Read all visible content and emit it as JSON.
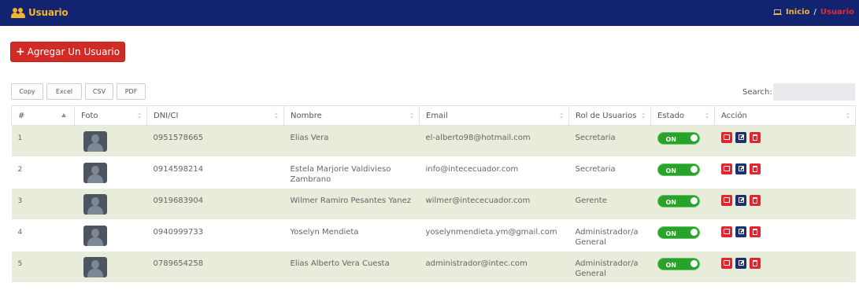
{
  "header": {
    "title": "Usuario",
    "breadcrumb": {
      "home": "Inicio",
      "separator": "/",
      "current": "Usuario"
    }
  },
  "toolbar": {
    "add_user_label": "Agregar Un Usuario"
  },
  "export_buttons": [
    "Copy",
    "Excel",
    "CSV",
    "PDF"
  ],
  "search": {
    "label": "Search:",
    "value": ""
  },
  "table": {
    "columns": [
      "#",
      "Foto",
      "DNI/CI",
      "Nombre",
      "Email",
      "Rol de Usuarios",
      "Estado",
      "Acción"
    ],
    "sorted_column": "#",
    "rows": [
      {
        "num": "1",
        "dni": "0951578665",
        "nombre": "Elias Vera",
        "email": "el-alberto98@hotmail.com",
        "rol": "Secretaria",
        "estado": "ON"
      },
      {
        "num": "2",
        "dni": "0914598214",
        "nombre": "Estela Marjorie Valdivieso Zambrano",
        "email": "info@intececuador.com",
        "rol": "Secretaria",
        "estado": "ON"
      },
      {
        "num": "3",
        "dni": "0919683904",
        "nombre": "Wilmer Ramiro Pesantes Yanez",
        "email": "wilmer@intececuador.com",
        "rol": "Gerente",
        "estado": "ON"
      },
      {
        "num": "4",
        "dni": "0940999733",
        "nombre": "Yoselyn Mendieta",
        "email": "yoselynmendieta.ym@gmail.com",
        "rol": "Administrador/a General",
        "estado": "ON"
      },
      {
        "num": "5",
        "dni": "0789654258",
        "nombre": "Elias Alberto Vera Cuesta",
        "email": "administrador@intec.com",
        "rol": "Administrador/a General",
        "estado": "ON"
      }
    ]
  },
  "colors": {
    "header_bg": "#122470",
    "title_accent": "#f3b52c",
    "breadcrumb_current": "#e52d2d",
    "add_button": "#d22a24",
    "row_stripe": "#e7ecdb",
    "toggle_on": "#29a329",
    "action_red": "#e3262e",
    "action_blue": "#1b3070"
  },
  "icons": {
    "title": "users-icon",
    "breadcrumb_home": "laptop-icon",
    "add": "plus-icon",
    "actions": [
      "view-icon",
      "edit-icon",
      "delete-icon"
    ]
  }
}
